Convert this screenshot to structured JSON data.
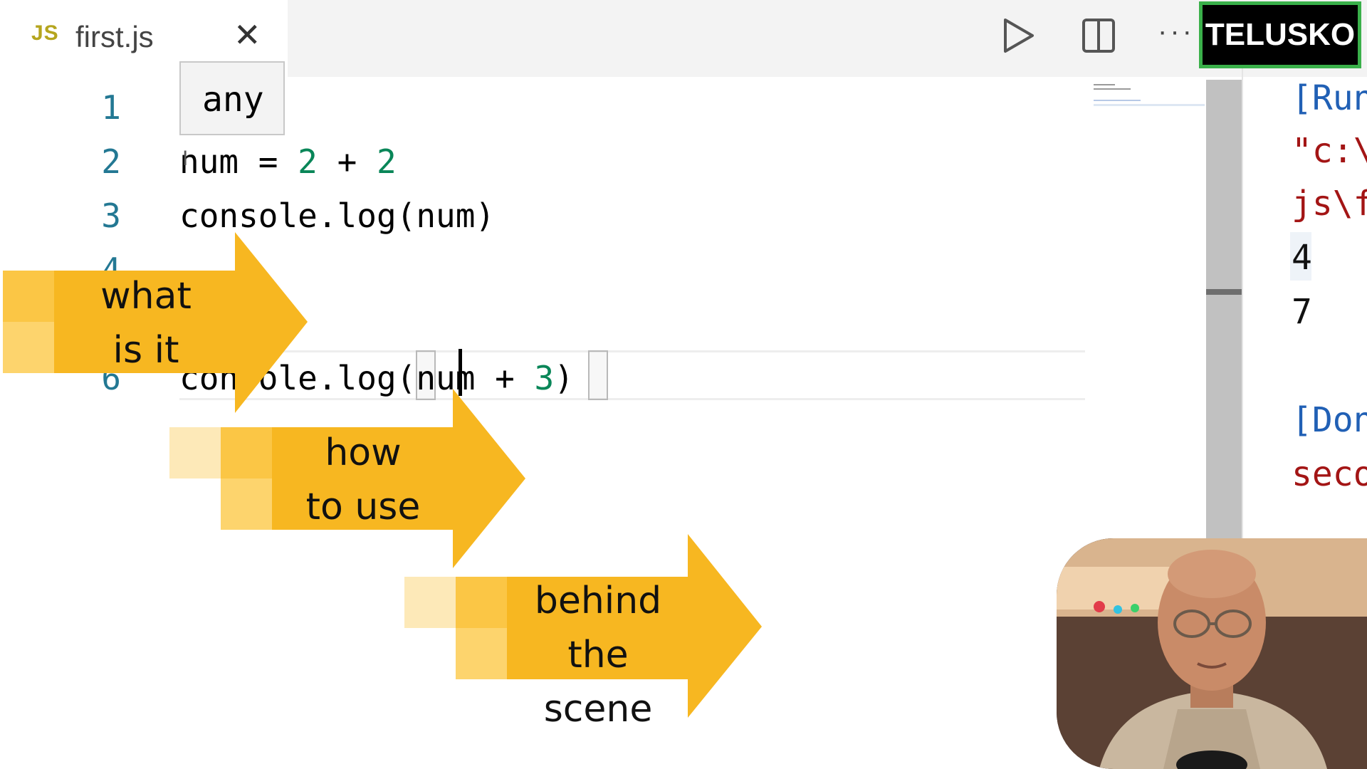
{
  "tab": {
    "icon_label": "JS",
    "filename": "first.js",
    "close_glyph": "✕"
  },
  "toolbar": {
    "run": "play-icon",
    "split": "split-editor-icon",
    "more": "···"
  },
  "brand": "TELUSKO",
  "hover": {
    "text": "any"
  },
  "editor": {
    "line_numbers": [
      "1",
      "2",
      "3",
      "4",
      "6"
    ],
    "line2": {
      "var": "num = ",
      "a": "2",
      "op": " + ",
      "b": "2"
    },
    "line3": "console.log(num)",
    "line6": {
      "start": "console.log(",
      "mid": "num + ",
      "num": "3",
      "end": ")"
    }
  },
  "output": {
    "line1": "[Run",
    "line2": "\"c:\\",
    "line3": "js\\f",
    "line4": "4",
    "line5": "7",
    "line6": "[Don",
    "line7": "seco"
  },
  "arrows": [
    {
      "line1": "what",
      "line2": "is it"
    },
    {
      "line1": "how",
      "line2": "to use"
    },
    {
      "line1": "behind the",
      "line2": "scene"
    }
  ],
  "colors": {
    "arrow": "#f7b721",
    "arrow_light": "#fbc645",
    "arrow_lighter": "#fdd46d",
    "arrow_faint": "#fde9b8",
    "brand_border": "#3ab04a"
  }
}
